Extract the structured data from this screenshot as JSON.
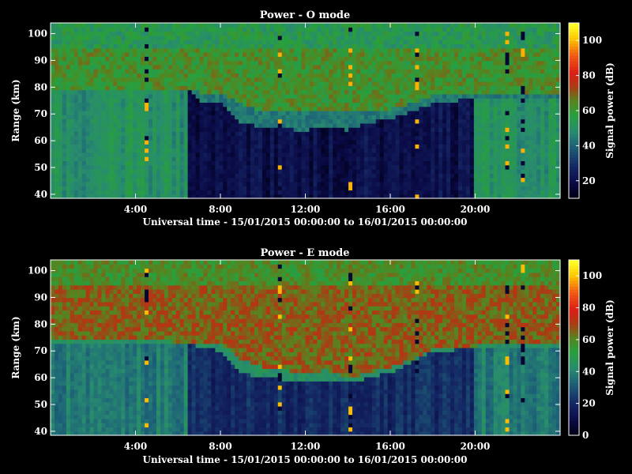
{
  "chart_data": [
    {
      "type": "heatmap",
      "title": "Power - O mode",
      "xlabel": "Universal time - 15/01/2015 00:00:00 to 16/01/2015 00:00:00",
      "ylabel": "Range (km)",
      "colorbar_label": "Signal power (dB)",
      "x_unit": "hours UT",
      "xlim": [
        0,
        24
      ],
      "ylim": [
        38.5,
        104
      ],
      "x_ticks": [
        4,
        8,
        12,
        16,
        20
      ],
      "x_tick_labels": [
        "4:00",
        "8:00",
        "12:00",
        "16:00",
        "20:00"
      ],
      "y_ticks": [
        40,
        50,
        60,
        70,
        80,
        90,
        100
      ],
      "y_tick_labels": [
        "40",
        "50",
        "60",
        "70",
        "80",
        "90",
        "100"
      ],
      "clim": [
        10,
        110
      ],
      "colorbar_ticks": [
        20,
        40,
        60,
        80,
        100
      ],
      "colorbar_tick_labels": [
        "20",
        "40",
        "60",
        "80",
        "100"
      ],
      "features": {
        "upper_layer_base_km": [
          [
            0,
            79
          ],
          [
            4,
            79.5
          ],
          [
            6,
            78.5
          ],
          [
            8,
            78
          ],
          [
            9,
            74
          ],
          [
            10,
            71
          ],
          [
            12,
            70.5
          ],
          [
            14,
            72
          ],
          [
            16,
            72
          ],
          [
            17,
            74
          ],
          [
            18,
            77
          ],
          [
            20,
            77.5
          ],
          [
            22,
            78
          ],
          [
            24,
            78
          ]
        ],
        "dark_region_top_km": [
          [
            0,
            82
          ],
          [
            6.5,
            80
          ],
          [
            7,
            75
          ],
          [
            8,
            74
          ],
          [
            9,
            67
          ],
          [
            10,
            65
          ],
          [
            12,
            64
          ],
          [
            13,
            65
          ],
          [
            14,
            64
          ],
          [
            15,
            67
          ],
          [
            16,
            68
          ],
          [
            17,
            71
          ],
          [
            18,
            74
          ],
          [
            19,
            75
          ],
          [
            20,
            76
          ],
          [
            24,
            76
          ]
        ],
        "upper_layer_dB": 62,
        "background_day_dB": 20,
        "background_early_dB": 50,
        "noisy_columns_hours": [
          4.5,
          10.8,
          14.2,
          17.2,
          21.5,
          22.3
        ]
      }
    },
    {
      "type": "heatmap",
      "title": "Power - E mode",
      "xlabel": "Universal time - 15/01/2015 00:00:00 to 16/01/2015 00:00:00",
      "ylabel": "Range (km)",
      "colorbar_label": "Signal power (dB)",
      "x_unit": "hours UT",
      "xlim": [
        0,
        24
      ],
      "ylim": [
        38.5,
        104
      ],
      "x_ticks": [
        4,
        8,
        12,
        16,
        20
      ],
      "x_tick_labels": [
        "4:00",
        "8:00",
        "12:00",
        "16:00",
        "20:00"
      ],
      "y_ticks": [
        40,
        50,
        60,
        70,
        80,
        90,
        100
      ],
      "y_tick_labels": [
        "40",
        "50",
        "60",
        "70",
        "80",
        "90",
        "100"
      ],
      "clim": [
        0,
        110
      ],
      "colorbar_ticks": [
        0,
        20,
        40,
        60,
        80,
        100
      ],
      "colorbar_tick_labels": [
        "0",
        "20",
        "40",
        "60",
        "80",
        "100"
      ],
      "features": {
        "upper_layer_base_km": [
          [
            0,
            74
          ],
          [
            4,
            74
          ],
          [
            6,
            73.5
          ],
          [
            8,
            73
          ],
          [
            9,
            67
          ],
          [
            10,
            64
          ],
          [
            12,
            62
          ],
          [
            13,
            63
          ],
          [
            14,
            60
          ],
          [
            15,
            62
          ],
          [
            16,
            64
          ],
          [
            17,
            67
          ],
          [
            18,
            71
          ],
          [
            20,
            72
          ],
          [
            24,
            73
          ]
        ],
        "dark_region_top_km": [
          [
            0,
            73
          ],
          [
            7,
            72
          ],
          [
            8,
            70
          ],
          [
            9,
            62
          ],
          [
            10,
            60
          ],
          [
            12,
            59
          ],
          [
            13,
            59
          ],
          [
            14,
            58
          ],
          [
            15,
            60
          ],
          [
            16,
            62
          ],
          [
            17,
            66
          ],
          [
            18,
            70
          ],
          [
            20,
            71
          ],
          [
            24,
            72
          ]
        ],
        "upper_layer_dB": 66,
        "background_day_dB": 20,
        "background_early_dB": 38,
        "noisy_columns_hours": [
          4.5,
          10.8,
          14.2,
          17.2,
          21.5,
          22.3
        ]
      }
    }
  ]
}
